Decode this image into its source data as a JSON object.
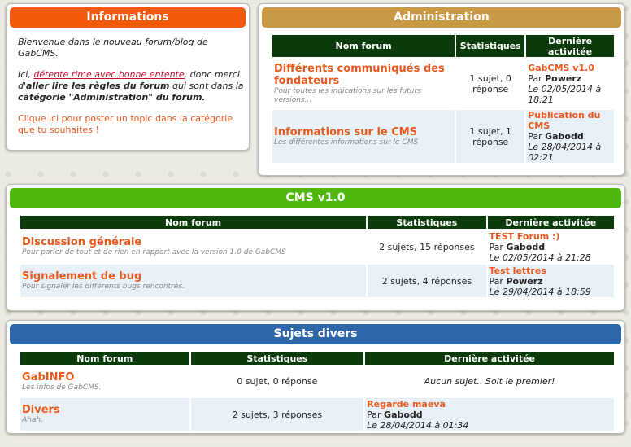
{
  "info": {
    "title": "Informations",
    "welcome": "Bienvenue dans le nouveau forum/blog de GabCMS.",
    "p2_a": "Ici, ",
    "p2_link": "détente rime avec bonne entente",
    "p2_b": ", donc merci d'",
    "p2_bold1": "aller lire les règles du forum",
    "p2_c": " qui sont dans la ",
    "p2_bold2": "catégorie \"Administration\" du forum.",
    "p3": "Clique ici pour poster un topic dans la catégorie que tu souhaites !"
  },
  "admin": {
    "title": "Administration",
    "headers": [
      "Nom forum",
      "Statistiques",
      "Dernière activitée"
    ],
    "rows": [
      {
        "name": "Différents communiqués des fondateurs",
        "desc": "Pour toutes les indications sur les futurs versions...",
        "stats": "1 sujet, 0 réponse",
        "last_title": "GabCMS v1.0",
        "by_label": "Par",
        "by_user": "Powerz",
        "date": "Le 02/05/2014 à 18:21"
      },
      {
        "name": "Informations sur le CMS",
        "desc": "Les différentes informations sur le CMS",
        "stats": "1 sujet, 1 réponse",
        "last_title": "Publication du CMS",
        "by_label": "Par",
        "by_user": "Gabodd",
        "date": "Le 28/04/2014 à 02:21"
      }
    ]
  },
  "cms": {
    "title": "CMS v1.0",
    "headers": [
      "Nom forum",
      "Statistiques",
      "Dernière activitée"
    ],
    "rows": [
      {
        "name": "Discussion générale",
        "desc": "Pour parler de tout et de rien en rapport avec la version 1.0 de GabCMS",
        "stats": "2 sujets, 15 réponses",
        "last_title": "TEST Forum :)",
        "by_label": "Par",
        "by_user": "Gabodd",
        "date": "Le 02/05/2014 à 21:28"
      },
      {
        "name": "Signalement de bug",
        "desc": "Pour signaler les différents bugs rencontrés.",
        "stats": "2 sujets, 4 réponses",
        "last_title": "Test lettres",
        "by_label": "Par",
        "by_user": "Powerz",
        "date": "Le 29/04/2014 à 18:59"
      }
    ]
  },
  "divers": {
    "title": "Sujets divers",
    "headers": [
      "Nom forum",
      "Statistiques",
      "Dernière activitée"
    ],
    "rows": [
      {
        "name": "GabINFO",
        "desc": "Les infos de GabCMS.",
        "stats": "0 sujet, 0 réponse",
        "none": "Aucun sujet.. Soit le premier!"
      },
      {
        "name": "Divers",
        "desc": "Ahah.",
        "stats": "2 sujets, 3 réponses",
        "last_title": "Regarde maeva",
        "by_label": "Par",
        "by_user": "Gabodd",
        "date": "Le 28/04/2014 à 01:34"
      }
    ]
  }
}
